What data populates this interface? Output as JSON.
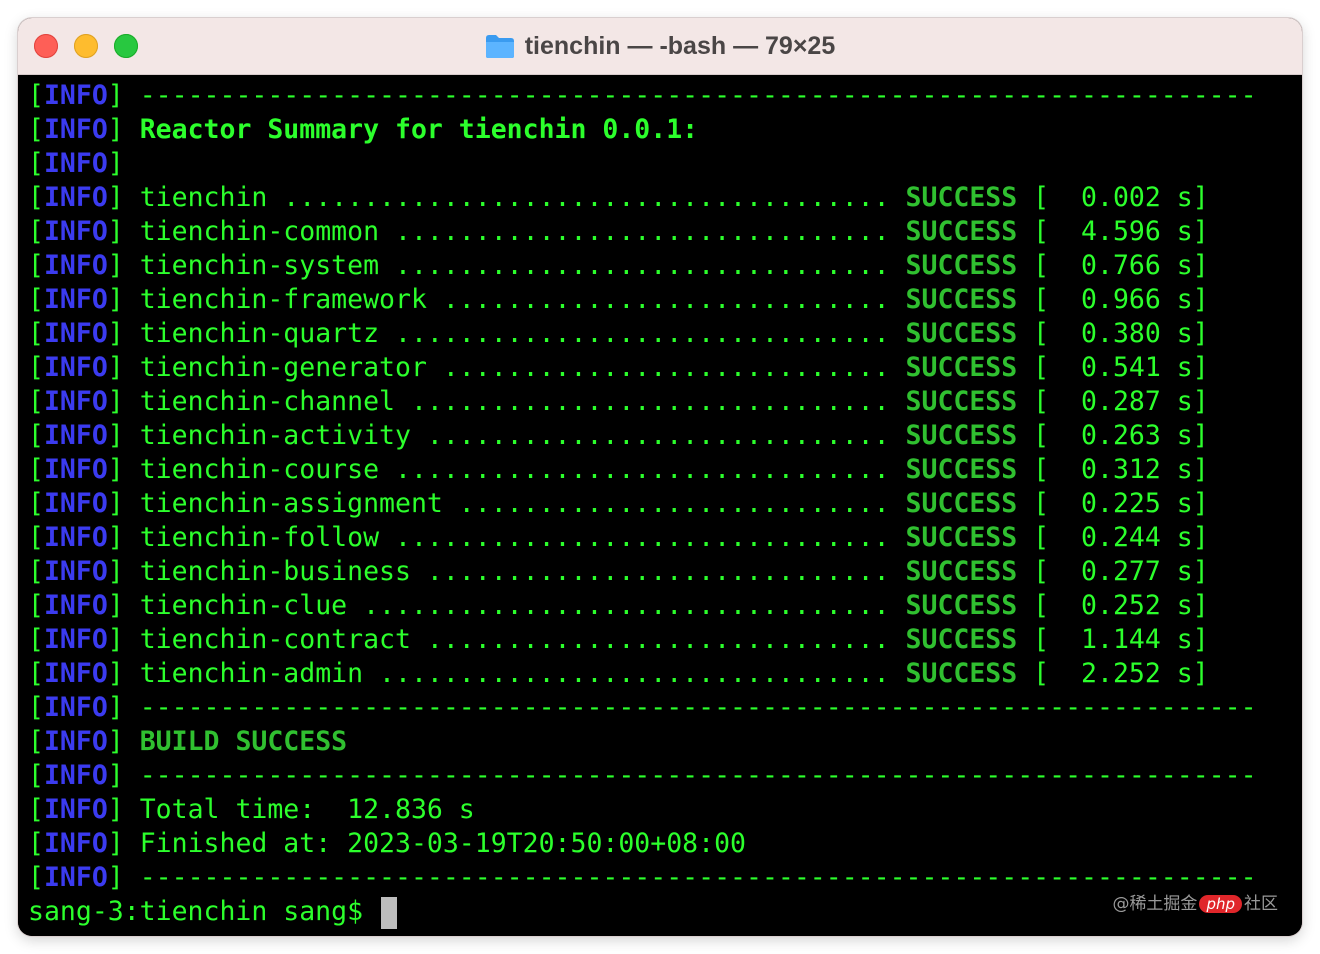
{
  "window": {
    "title": "tienchin — -bash — 79×25",
    "title_icon": "folder-icon"
  },
  "terminal": {
    "prefix_tag": "INFO",
    "separator": "----------------------------------------------------------------------",
    "reactor_summary": "Reactor Summary for tienchin 0.0.1:",
    "modules": [
      {
        "name": "tienchin ......................................",
        "status": "SUCCESS",
        "time": "0.002"
      },
      {
        "name": "tienchin-common ...............................",
        "status": "SUCCESS",
        "time": "4.596"
      },
      {
        "name": "tienchin-system ...............................",
        "status": "SUCCESS",
        "time": "0.766"
      },
      {
        "name": "tienchin-framework ............................",
        "status": "SUCCESS",
        "time": "0.966"
      },
      {
        "name": "tienchin-quartz ...............................",
        "status": "SUCCESS",
        "time": "0.380"
      },
      {
        "name": "tienchin-generator ............................",
        "status": "SUCCESS",
        "time": "0.541"
      },
      {
        "name": "tienchin-channel ..............................",
        "status": "SUCCESS",
        "time": "0.287"
      },
      {
        "name": "tienchin-activity .............................",
        "status": "SUCCESS",
        "time": "0.263"
      },
      {
        "name": "tienchin-course ...............................",
        "status": "SUCCESS",
        "time": "0.312"
      },
      {
        "name": "tienchin-assignment ...........................",
        "status": "SUCCESS",
        "time": "0.225"
      },
      {
        "name": "tienchin-follow ...............................",
        "status": "SUCCESS",
        "time": "0.244"
      },
      {
        "name": "tienchin-business .............................",
        "status": "SUCCESS",
        "time": "0.277"
      },
      {
        "name": "tienchin-clue .................................",
        "status": "SUCCESS",
        "time": "0.252"
      },
      {
        "name": "tienchin-contract .............................",
        "status": "SUCCESS",
        "time": "1.144"
      },
      {
        "name": "tienchin-admin ................................",
        "status": "SUCCESS",
        "time": "2.252"
      }
    ],
    "time_unit": "s",
    "build_result": "BUILD SUCCESS",
    "total_time": "Total time:  12.836 s",
    "finished_at": "Finished at: 2023-03-19T20:50:00+08:00",
    "prompt": "sang-3:tienchin sang$ "
  },
  "watermark": {
    "left": "@稀土掘金",
    "badge": "php",
    "right": "社区"
  },
  "colors": {
    "text_green": "#2cff2c",
    "info_blue": "#3b3bf0",
    "success_green": "#30c030",
    "background": "#000000"
  }
}
